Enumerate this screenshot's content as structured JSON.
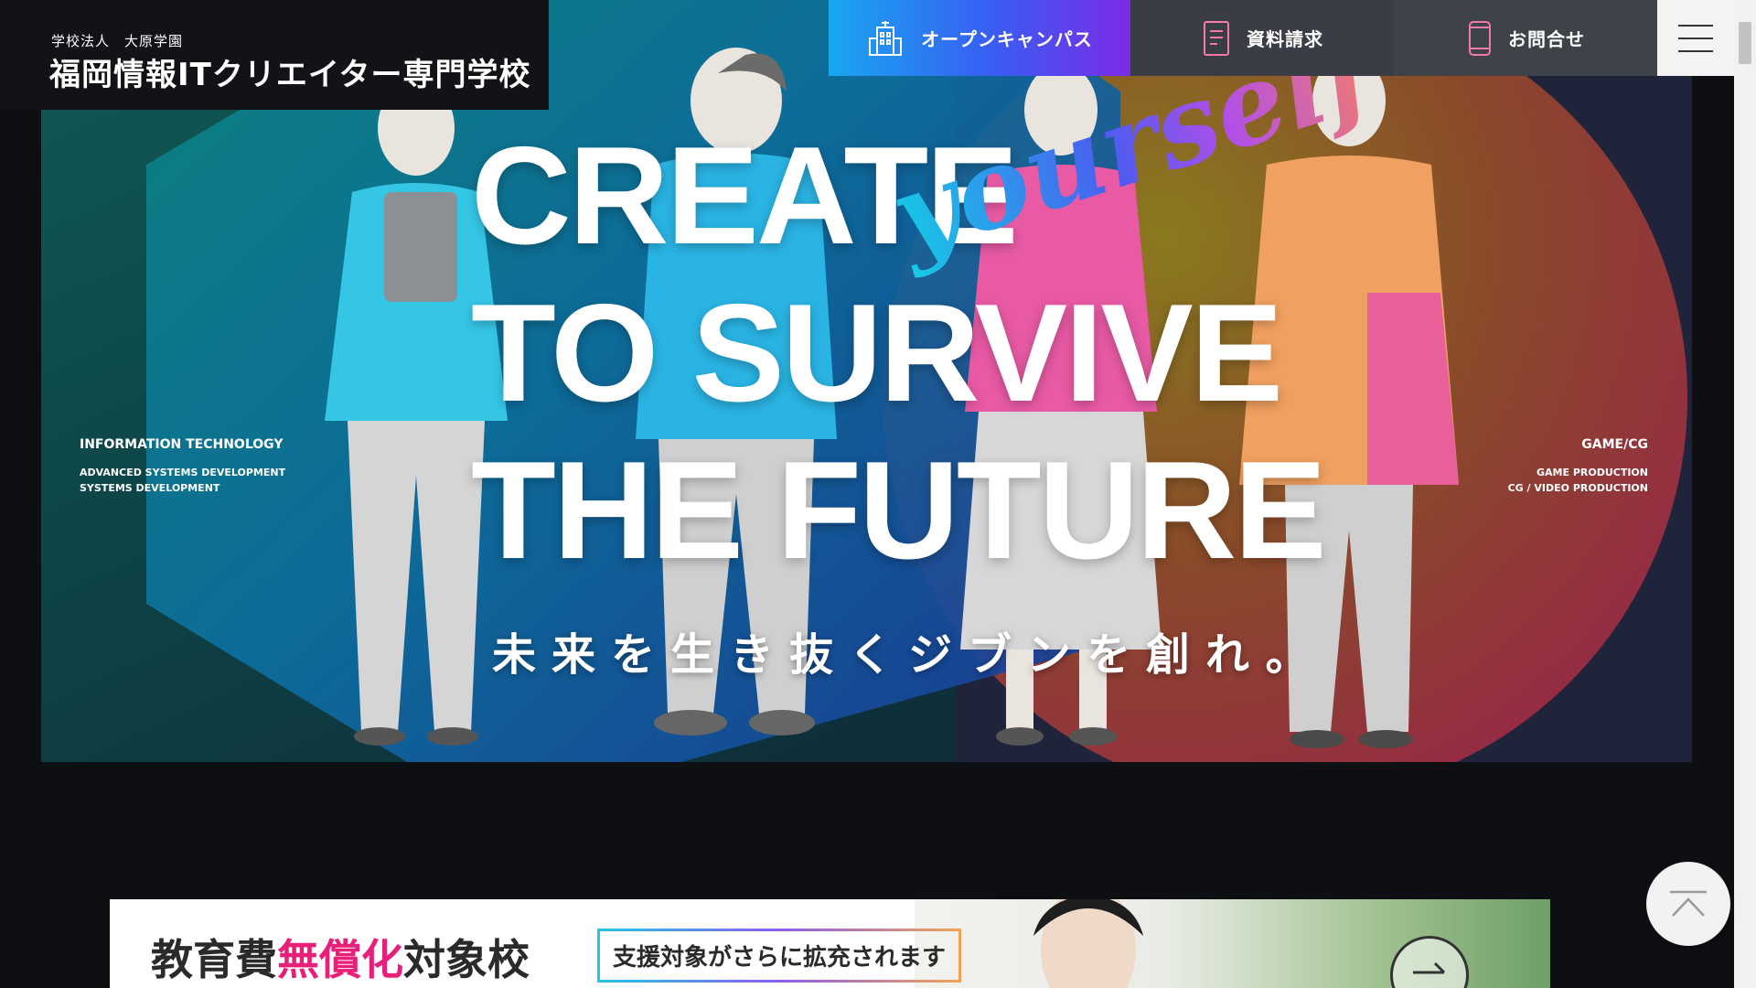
{
  "header": {
    "logo_sub": "学校法人　大原学園",
    "logo_main": "福岡情報ITクリエイター専門学校"
  },
  "nav": {
    "open_campus": "オープンキャンパス",
    "documents": "資料請求",
    "contact": "お問合せ"
  },
  "hero": {
    "line1": "CREATE",
    "line2": "TO SURVIVE",
    "line3": "THE FUTURE",
    "script": "yourself",
    "jp_tagline": "未来を生き抜くジブンを創れ。",
    "left_field": {
      "title": "INFORMATION TECHNOLOGY",
      "items": [
        "ADVANCED SYSTEMS DEVELOPMENT",
        "SYSTEMS DEVELOPMENT"
      ]
    },
    "right_field": {
      "title": "GAME/CG",
      "items": [
        "GAME PRODUCTION",
        "CG / VIDEO PRODUCTION"
      ]
    }
  },
  "banner": {
    "title_pre": "教育費",
    "title_pink": "無償化",
    "title_post": "対象校",
    "badge": "支援対象がさらに拡充されます"
  },
  "icons": {
    "open_campus": "building-icon",
    "documents": "document-icon",
    "contact": "phone-icon",
    "menu": "hamburger-menu-icon",
    "to_top": "arrow-up-icon",
    "banner_arrow": "arrow-right-icon"
  },
  "colors": {
    "nav_gradient_start": "#19a7f0",
    "nav_gradient_end": "#7b2be6",
    "pink_accent": "#e8207a"
  }
}
